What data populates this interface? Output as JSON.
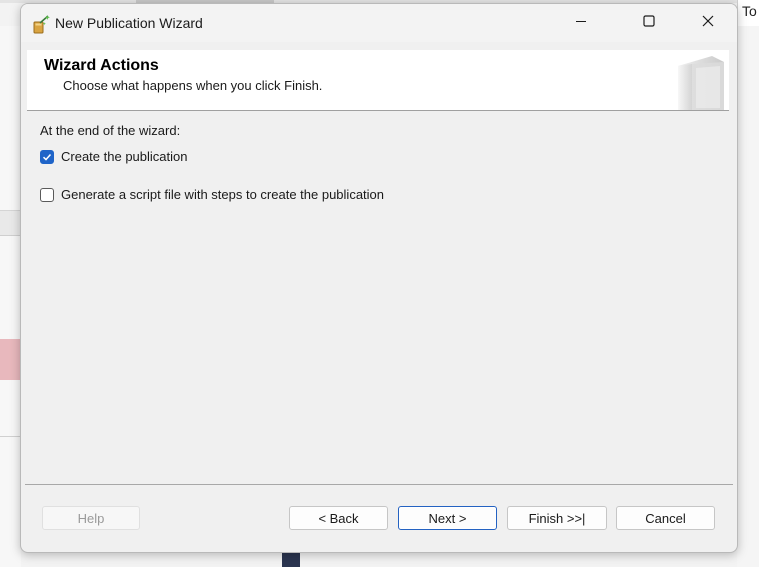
{
  "background": {
    "top_right_text": "To"
  },
  "window": {
    "title": "New Publication Wizard",
    "app_icon": "wizard-wand-icon",
    "controls": {
      "minimize_icon": "minimize-icon",
      "maximize_icon": "maximize-icon",
      "close_icon": "close-icon"
    }
  },
  "header": {
    "title": "Wizard Actions",
    "subtitle": "Choose what happens when you click Finish.",
    "graphic": "book-graphic"
  },
  "body": {
    "section_label": "At the end of the wizard:",
    "options": [
      {
        "label": "Create the publication",
        "checked": true
      },
      {
        "label": "Generate a script file with steps to create the publication",
        "checked": false
      }
    ]
  },
  "buttons": {
    "help": "Help",
    "back": "< Back",
    "next": "Next >",
    "finish": "Finish >>|",
    "cancel": "Cancel"
  },
  "colors": {
    "accent": "#1f64c8",
    "default_button_border": "#2462c2",
    "header_background": "#ffffff",
    "dialog_background": "#f0f0f0"
  }
}
